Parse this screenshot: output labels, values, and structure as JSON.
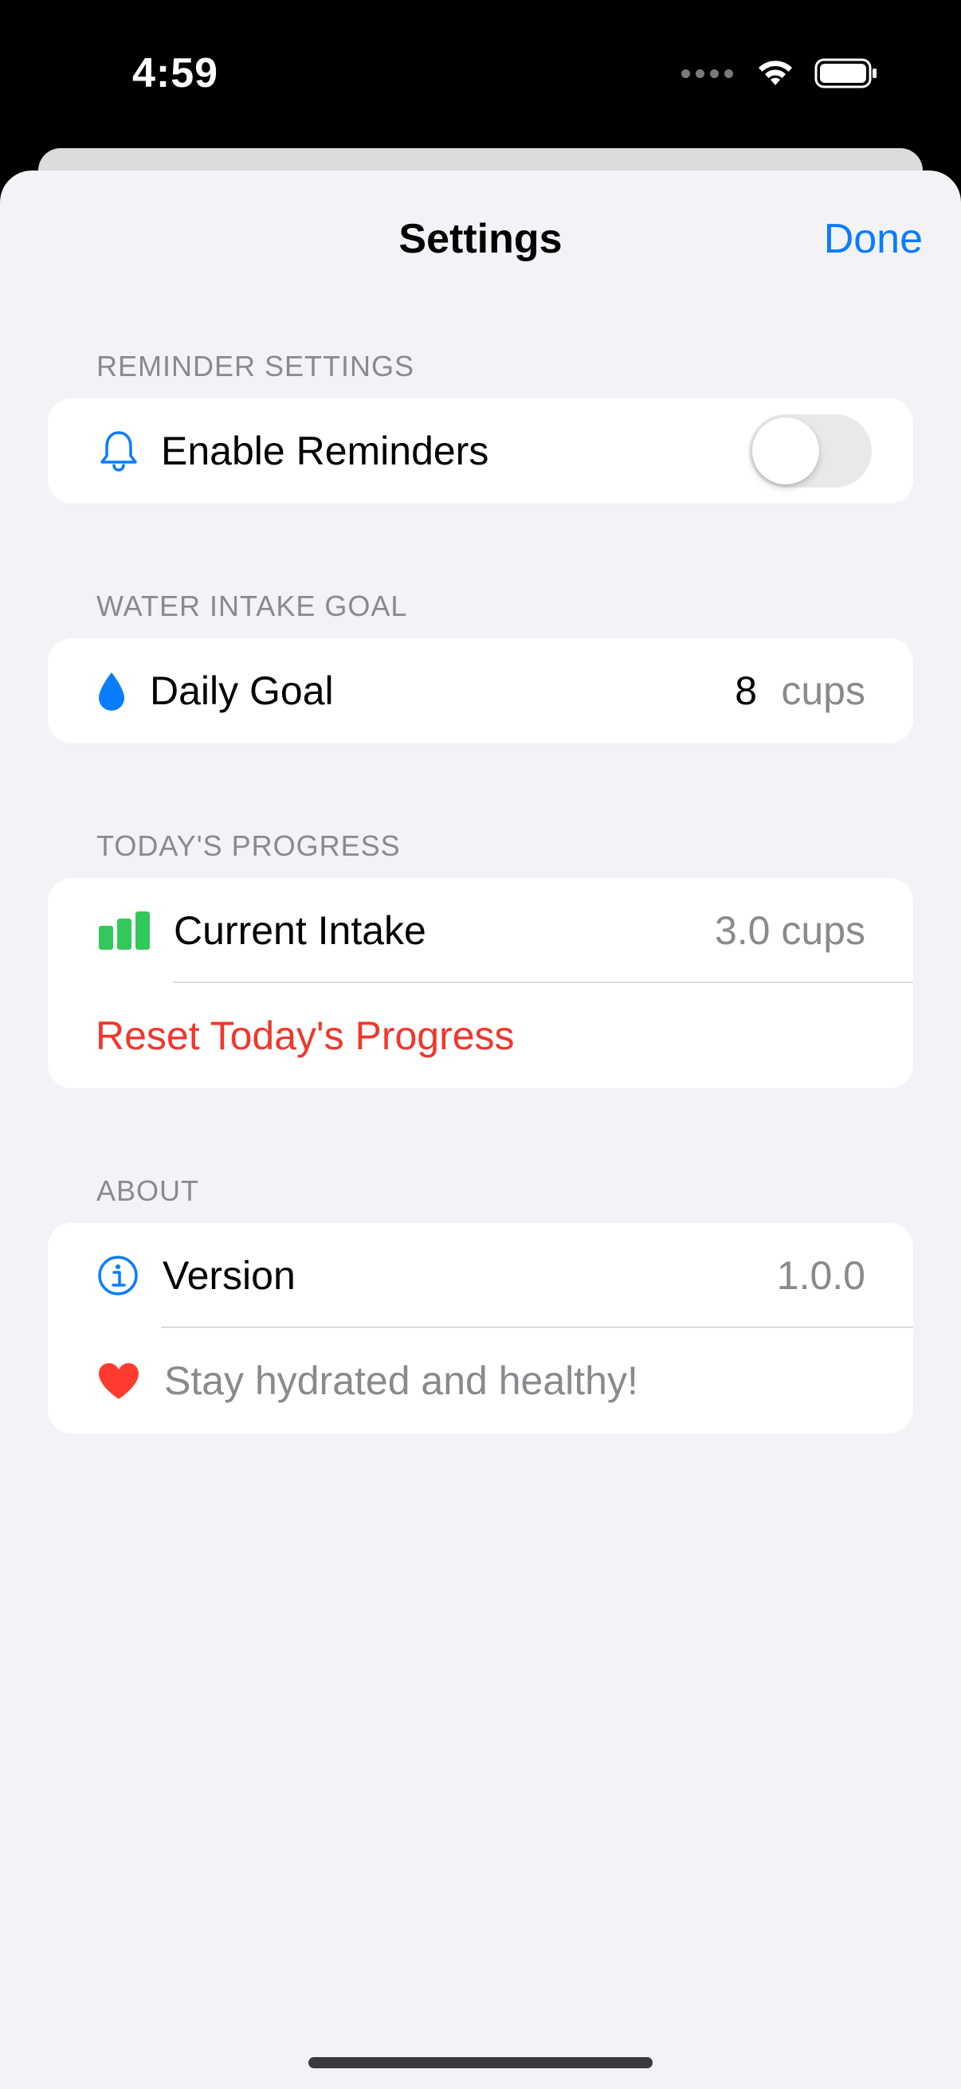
{
  "status_bar": {
    "time": "4:59"
  },
  "nav": {
    "title": "Settings",
    "done_label": "Done"
  },
  "sections": {
    "reminders": {
      "header": "REMINDER SETTINGS",
      "enable_label": "Enable Reminders",
      "enabled": false
    },
    "goal": {
      "header": "WATER INTAKE GOAL",
      "label": "Daily Goal",
      "value": "8",
      "unit": "cups"
    },
    "progress": {
      "header": "TODAY'S PROGRESS",
      "current_label": "Current Intake",
      "current_value": "3.0 cups",
      "reset_label": "Reset Today's Progress"
    },
    "about": {
      "header": "ABOUT",
      "version_label": "Version",
      "version_value": "1.0.0",
      "tagline": "Stay hydrated and healthy!"
    }
  },
  "colors": {
    "accent": "#0a7cff",
    "destructive": "#f2362c",
    "success": "#34c759",
    "heart": "#ff3b30"
  },
  "icons": [
    "bell-icon",
    "water-drop-icon",
    "bar-chart-icon",
    "info-icon",
    "heart-icon",
    "wifi-icon",
    "battery-icon"
  ]
}
